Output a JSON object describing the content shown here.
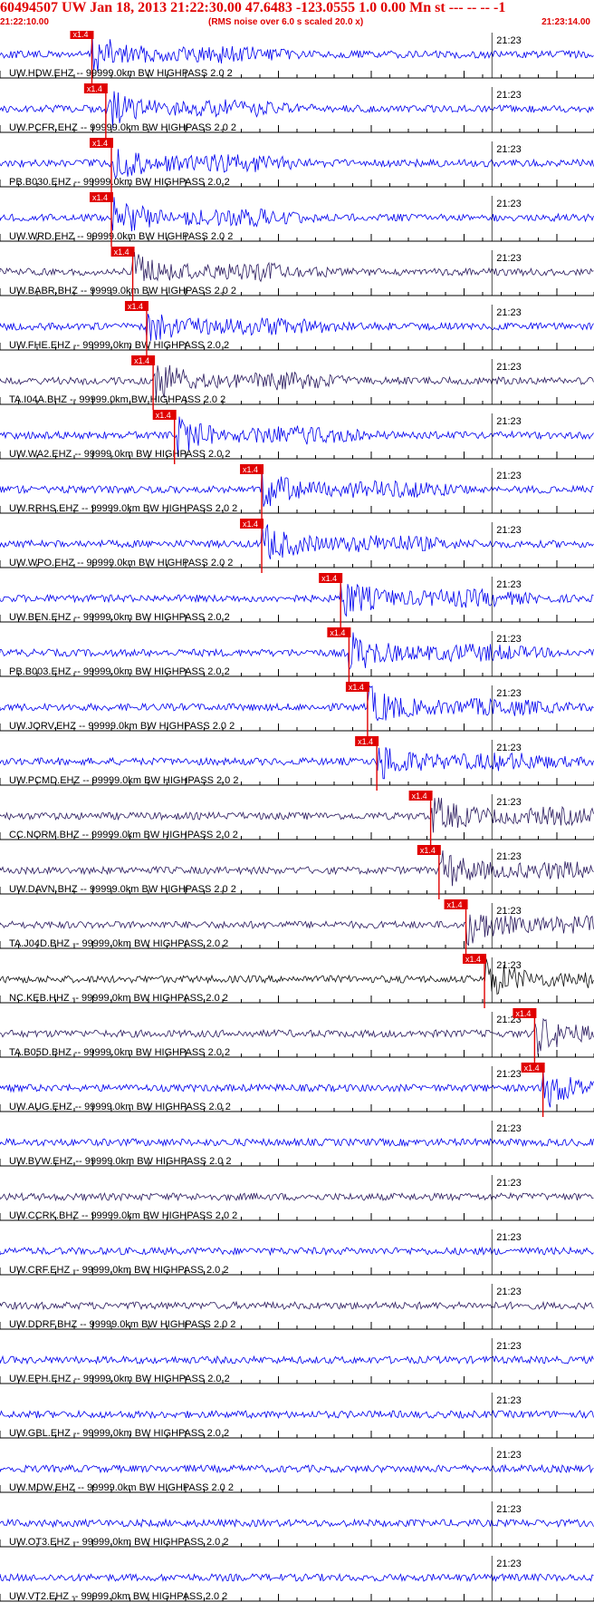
{
  "header": {
    "title": "60494507 UW Jan 18, 2013 21:22:30.00   47.6483 -123.0555  1.0 0.00 Mn st --- -- --   -1",
    "start_time": "21:22:10.00",
    "rms_note": "(RMS noise over 6.0 s scaled 20.0 x)",
    "end_time": "21:23:14.00"
  },
  "chart_data": {
    "type": "line",
    "title": "60494507 UW Jan 18, 2013 21:22:30.00",
    "x_time_range": [
      "21:22:10.00",
      "21:23:14.00"
    ],
    "minute_label": "21:23",
    "pick_label": "x1.4",
    "colors": {
      "trace_blue": "#0000ee",
      "trace_navy": "#2a1a5e",
      "trace_black": "#111111",
      "pick_red": "#e00000",
      "header_red": "#e00000"
    },
    "series": [
      {
        "name": "UW.HDW.EHZ -- 99999.0km BW  HIGHPASS  2.0  2",
        "pick_s": 9.9,
        "color": "blue"
      },
      {
        "name": "UW.PCFR.EHZ -- 99999.0km BW  HIGHPASS  2.0  2",
        "pick_s": 11.4,
        "color": "blue"
      },
      {
        "name": "PB.B030.EHZ -- 99999.0km BW  HIGHPASS  2.0  2",
        "pick_s": 12.0,
        "color": "blue"
      },
      {
        "name": "UW.WRD.EHZ -- 99999.0km BW  HIGHPASS  2.0  2",
        "pick_s": 12.0,
        "color": "blue"
      },
      {
        "name": "UW.BABR.BHZ -- 99999.0km BW  HIGHPASS  2.0  2",
        "pick_s": 14.3,
        "color": "navy"
      },
      {
        "name": "UW.FHE.EHZ -- 99999.0km BW  HIGHPASS  2.0  2",
        "pick_s": 15.8,
        "color": "blue"
      },
      {
        "name": "TA.I04A.BHZ -- 99999.0km BW  HIGHPASS  2.0  2",
        "pick_s": 16.5,
        "color": "navy"
      },
      {
        "name": "UW.WA2.EHZ -- 99999.0km BW  HIGHPASS  2.0  2",
        "pick_s": 18.8,
        "color": "blue"
      },
      {
        "name": "UW.RRHS.EHZ -- 99999.0km BW  HIGHPASS  2.0  2",
        "pick_s": 28.2,
        "color": "blue"
      },
      {
        "name": "UW.WPO.EHZ -- 99999.0km BW  HIGHPASS  2.0  2",
        "pick_s": 28.2,
        "color": "blue"
      },
      {
        "name": "UW.BEN.EHZ -- 99999.0km BW  HIGHPASS  2.0  2",
        "pick_s": 36.7,
        "color": "blue"
      },
      {
        "name": "PB.B003.EHZ -- 99999.0km BW  HIGHPASS  2.0  2",
        "pick_s": 37.6,
        "color": "blue"
      },
      {
        "name": "UW.JORV.EHZ -- 99999.0km BW  HIGHPASS  2.0  2",
        "pick_s": 39.6,
        "color": "blue"
      },
      {
        "name": "UW.PCMD.EHZ -- 99999.0km BW  HIGHPASS  2.0  2",
        "pick_s": 40.6,
        "color": "blue"
      },
      {
        "name": "CC.NORM.BHZ -- 99999.0km BW  HIGHPASS  2.0  2",
        "pick_s": 46.4,
        "color": "navy"
      },
      {
        "name": "UW.DAVN.BHZ -- 99999.0km BW  HIGHPASS  2.0  2",
        "pick_s": 47.3,
        "color": "navy"
      },
      {
        "name": "TA.J04D.BHZ -- 99999.0km BW  HIGHPASS  2.0  2",
        "pick_s": 50.2,
        "color": "navy"
      },
      {
        "name": "NC.KEB.HHZ -- 99999.0km BW  HIGHPASS  2.0  2",
        "pick_s": 52.2,
        "color": "black"
      },
      {
        "name": "TA.B05D.BHZ -- 99999.0km BW  HIGHPASS  2.0  2",
        "pick_s": 57.6,
        "color": "navy"
      },
      {
        "name": "UW.AUG.EHZ -- 99999.0km BW  HIGHPASS  2.0  2",
        "pick_s": 58.5,
        "color": "blue"
      },
      {
        "name": "UW.BVW.EHZ -- 99999.0km BW  HIGHPASS  2.0  2",
        "pick_s": null,
        "color": "blue"
      },
      {
        "name": "UW.CCRK.BHZ -- 99999.0km BW  HIGHPASS  2.0  2",
        "pick_s": null,
        "color": "navy"
      },
      {
        "name": "UW.CRF.EHZ -- 99999.0km BW  HIGHPASS  2.0  2",
        "pick_s": null,
        "color": "blue"
      },
      {
        "name": "UW.DDRF.BHZ -- 99999.0km BW  HIGHPASS  2.0  2",
        "pick_s": null,
        "color": "navy"
      },
      {
        "name": "UW.EPH.EHZ -- 99999.0km BW  HIGHPASS  2.0  2",
        "pick_s": null,
        "color": "blue"
      },
      {
        "name": "UW.GBL.EHZ -- 99999.0km BW  HIGHPASS  2.0  2",
        "pick_s": null,
        "color": "blue"
      },
      {
        "name": "UW.MDW.EHZ -- 99999.0km BW  HIGHPASS  2.0  2",
        "pick_s": null,
        "color": "blue"
      },
      {
        "name": "UW.OT3.EHZ -- 99999.0km BW  HIGHPASS  2.0  2",
        "pick_s": null,
        "color": "blue"
      },
      {
        "name": "UW.VT2.EHZ -- 99999.0km BW  HIGHPASS  2.0  2",
        "pick_s": null,
        "color": "blue"
      }
    ]
  }
}
